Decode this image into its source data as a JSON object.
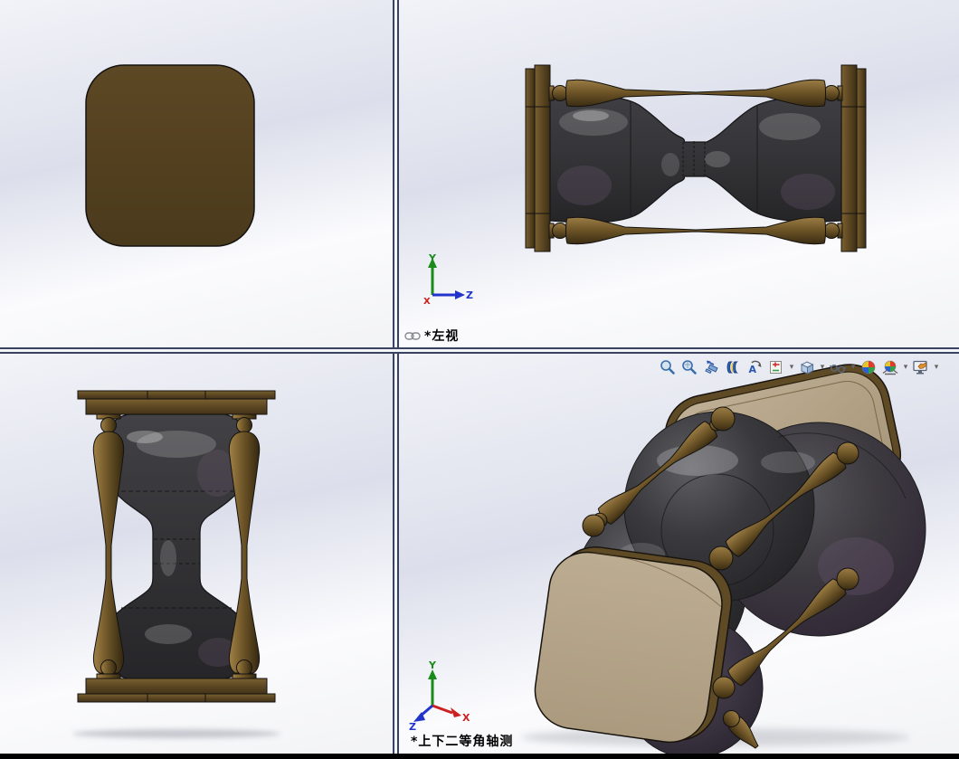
{
  "application": "SolidWorks multi-view model viewport",
  "viewports": {
    "top_left": {
      "view": "top",
      "label": ""
    },
    "top_right": {
      "view": "left",
      "label": "*左视",
      "linked": true
    },
    "bottom_left": {
      "view": "front",
      "label": ""
    },
    "bottom_right": {
      "view": "isometric",
      "label": "*上下二等角轴测"
    }
  },
  "axis_triad": {
    "x": "X",
    "y": "Y",
    "z": "Z",
    "x_color": "#cc2020",
    "y_color": "#1a8a1a",
    "z_color": "#2233cc"
  },
  "heads_up_toolbar": {
    "items": [
      {
        "name": "zoom-to-fit",
        "dropdown": false
      },
      {
        "name": "zoom-to-area",
        "dropdown": false
      },
      {
        "name": "previous-view",
        "dropdown": false
      },
      {
        "name": "section-view",
        "dropdown": false
      },
      {
        "name": "dynamic-annotation-views",
        "dropdown": false
      },
      {
        "name": "view-orientation-sheet",
        "dropdown": true
      },
      {
        "name": "view-orientation-cube",
        "dropdown": true
      },
      {
        "name": "hide-show-items",
        "dropdown": true
      },
      {
        "name": "edit-appearance",
        "dropdown": false
      },
      {
        "name": "apply-scene",
        "dropdown": true
      },
      {
        "name": "view-settings",
        "dropdown": true
      }
    ]
  },
  "materials": {
    "wood_dark": "#53401f",
    "wood_brass": "#7a5f2e",
    "plate_tan": "#b5a68c",
    "glass_dark": "#39393c",
    "glass_purple": "#4b3f4e"
  },
  "background": {
    "gradient_top": "#f2f3f8",
    "gradient_mid": "#dcdfeb",
    "gradient_bottom": "#f2f3f5",
    "divider": "#39435f",
    "bottom_bar": "#000000"
  }
}
